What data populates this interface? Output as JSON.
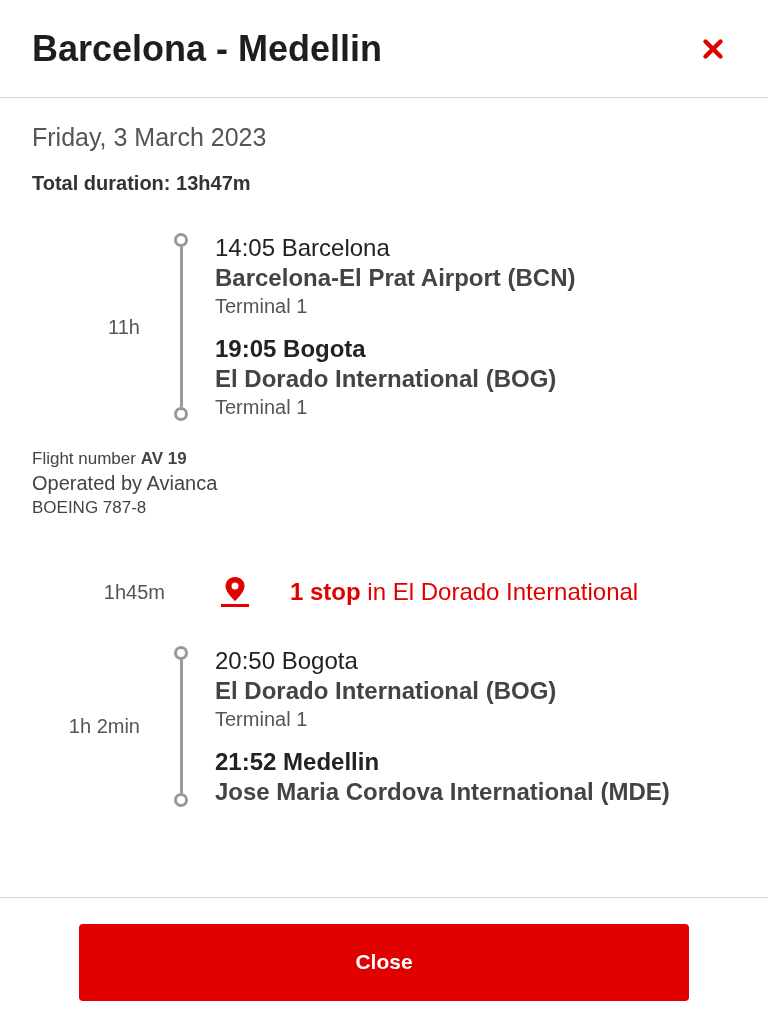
{
  "title": "Barcelona - Medellin",
  "date": "Friday, 3 March 2023",
  "total_duration": "Total duration: 13h47m",
  "itinerary": [
    {
      "kind": "segment",
      "duration": "11h",
      "departure": {
        "time_city": "14:05 Barcelona",
        "airport": "Barcelona-El Prat Airport (BCN)",
        "terminal": "Terminal 1"
      },
      "arrival": {
        "time_city": "19:05 Bogota",
        "airport": "El Dorado International (BOG)",
        "terminal": "Terminal 1"
      },
      "flight": {
        "number_label": "Flight number",
        "number": "AV 19",
        "operator": "Operated by Avianca",
        "aircraft": "BOEING 787-8"
      }
    },
    {
      "kind": "stop",
      "duration": "1h45m",
      "text": "**1 stop** in El Dorado International"
    },
    {
      "kind": "segment",
      "duration": "1h 2min",
      "departure": {
        "time_city": "20:50 Bogota",
        "airport": "El Dorado International (BOG)",
        "terminal": "Terminal 1"
      },
      "arrival": {
        "time_city": "21:52 Medellin",
        "airport": "Jose Maria Cordova International (MDE)"
      }
    }
  ],
  "close_button": "Close"
}
